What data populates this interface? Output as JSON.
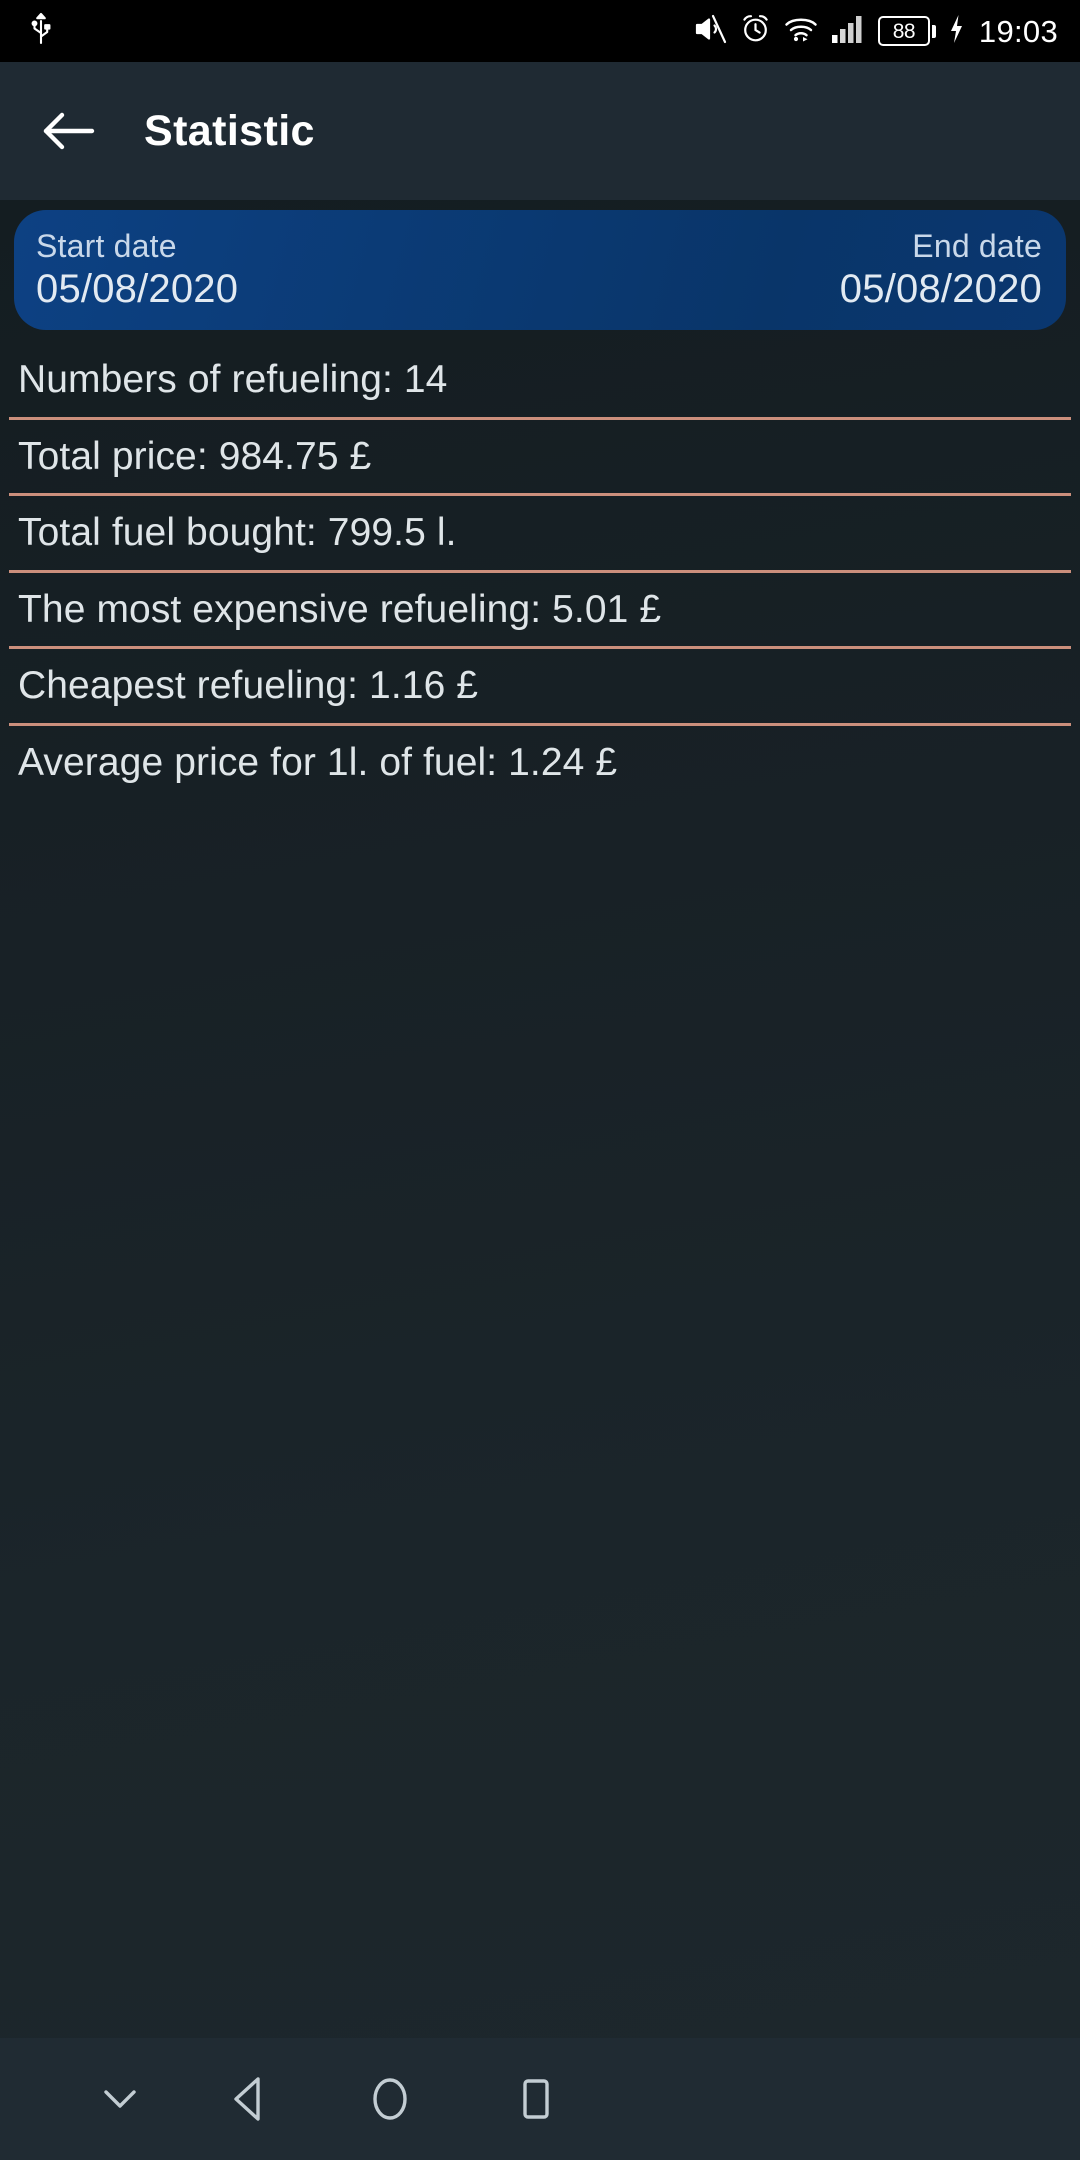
{
  "status_bar": {
    "usb_icon": "usb-icon",
    "mute_icon": "mute-icon",
    "alarm_icon": "alarm-clock-icon",
    "wifi_icon": "wifi-icon",
    "signal_icon": "cellular-signal-icon",
    "battery_level": "88",
    "charging_icon": "charging-bolt-icon",
    "clock": "19:03"
  },
  "toolbar": {
    "back_icon": "back-arrow-icon",
    "title": "Statistic"
  },
  "date_card": {
    "start_label": "Start date",
    "start_value": "05/08/2020",
    "end_label": "End date",
    "end_value": "05/08/2020",
    "background_color": "#0b3b76"
  },
  "stats": {
    "divider_color": "#cb8f7c",
    "rows": [
      {
        "text": "Numbers of refueling: 14"
      },
      {
        "text": "Total price: 984.75 £"
      },
      {
        "text": "Total fuel bought: 799.5 l."
      },
      {
        "text": "The most expensive refueling: 5.01 £"
      },
      {
        "text": "Cheapest refueling: 1.16 £"
      },
      {
        "text": "Average price for 1l. of fuel: 1.24 £"
      }
    ]
  },
  "nav_bar": {
    "hide_keyboard_icon": "chevron-down-icon",
    "back_icon": "nav-back-triangle-icon",
    "home_icon": "nav-home-circle-icon",
    "recents_icon": "nav-recents-square-icon"
  }
}
